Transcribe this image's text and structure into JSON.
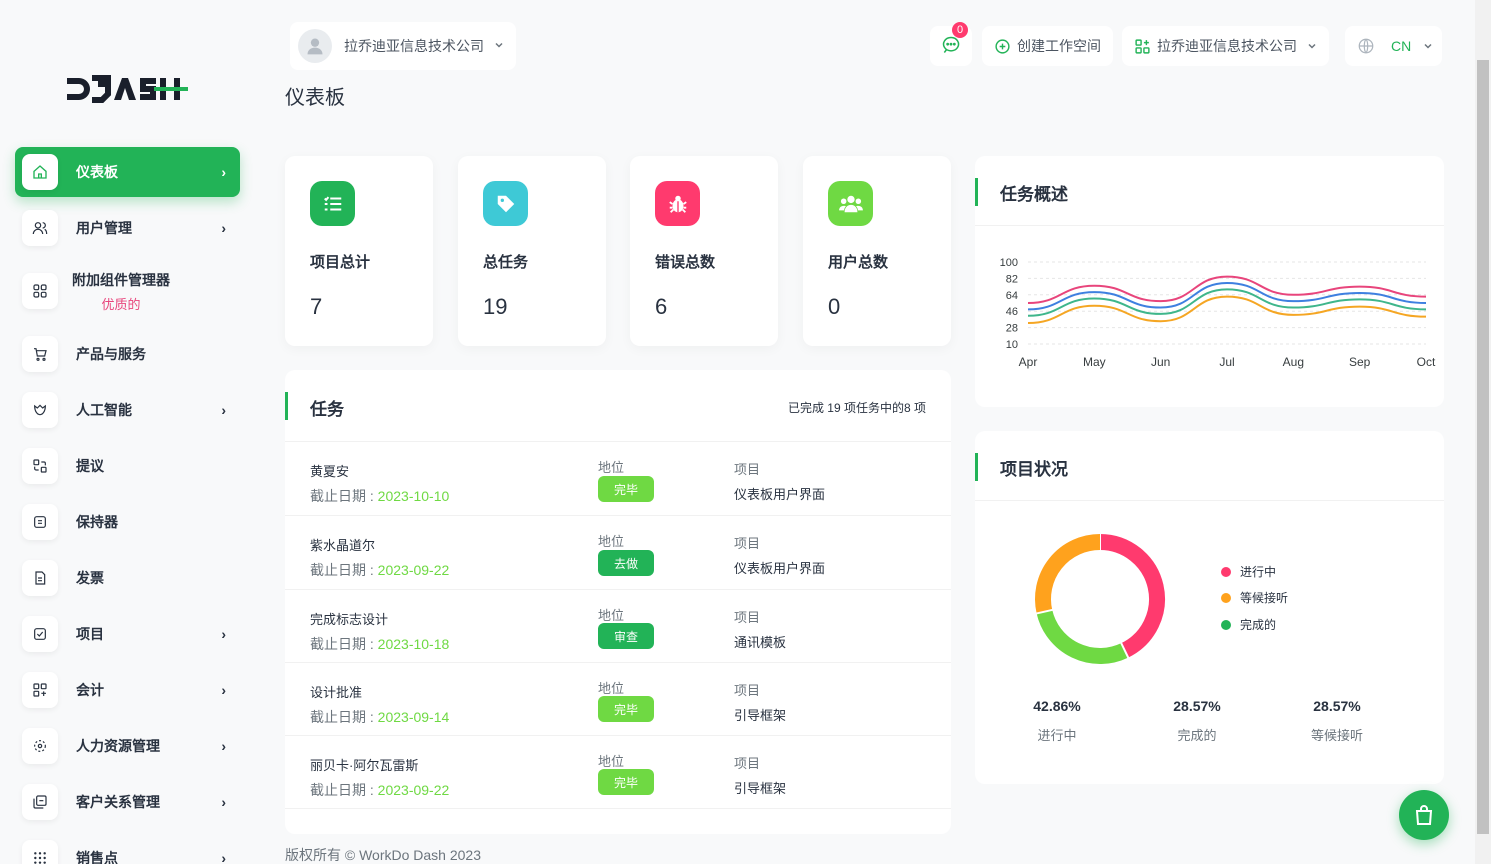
{
  "brand": {
    "logo_text": "DASH",
    "accent": "#22b357"
  },
  "header": {
    "company": "拉乔迪亚信息技术公司",
    "message_count": "0",
    "create_workspace": "创建工作空间",
    "workspace": "拉乔迪亚信息技术公司",
    "language": "CN"
  },
  "page_title": "仪表板",
  "sidebar": {
    "items": [
      {
        "label": "仪表板",
        "icon": "home-icon",
        "chevron": "›"
      },
      {
        "label": "用户管理",
        "icon": "users-icon",
        "chevron": "›"
      },
      {
        "label": "附加组件管理器",
        "sub": "优质的",
        "icon": "grid-icon"
      },
      {
        "label": "产品与服务",
        "icon": "cart-icon"
      },
      {
        "label": "人工智能",
        "icon": "ai-icon",
        "chevron": "›"
      },
      {
        "label": "提议",
        "icon": "proposal-icon"
      },
      {
        "label": "保持器",
        "icon": "retainer-icon"
      },
      {
        "label": "发票",
        "icon": "invoice-icon"
      },
      {
        "label": "项目",
        "icon": "project-icon",
        "chevron": "›"
      },
      {
        "label": "会计",
        "icon": "accounting-icon",
        "chevron": "›"
      },
      {
        "label": "人力资源管理",
        "icon": "hrm-icon",
        "chevron": "›"
      },
      {
        "label": "客户关系管理",
        "icon": "crm-icon",
        "chevron": "›"
      },
      {
        "label": "销售点",
        "icon": "pos-icon",
        "chevron": "›"
      }
    ]
  },
  "stats": [
    {
      "label": "项目总计",
      "value": "7",
      "color": "#22b357",
      "icon": "list-check-icon"
    },
    {
      "label": "总任务",
      "value": "19",
      "color": "#3ec9d6",
      "icon": "tag-icon"
    },
    {
      "label": "错误总数",
      "value": "6",
      "color": "#ff3a6e",
      "icon": "bug-icon"
    },
    {
      "label": "用户总数",
      "value": "0",
      "color": "#6fd943",
      "icon": "users-icon"
    }
  ],
  "tasks": {
    "title": "任务",
    "summary": "已完成 19 项任务中的8 项",
    "status_label": "地位",
    "project_label": "项目",
    "due_prefix": "截止日期 : ",
    "rows": [
      {
        "name": "黄夏安",
        "due": "2023-10-10",
        "status": "完毕",
        "status_color": "#6fd943",
        "project": "仪表板用户界面"
      },
      {
        "name": "紫水晶道尔",
        "due": "2023-09-22",
        "status": "去做",
        "status_color": "#22b357",
        "project": "仪表板用户界面"
      },
      {
        "name": "完成标志设计",
        "due": "2023-10-18",
        "status": "审查",
        "status_color": "#22b357",
        "project": "通讯模板"
      },
      {
        "name": "设计批准",
        "due": "2023-09-14",
        "status": "完毕",
        "status_color": "#6fd943",
        "project": "引导框架"
      },
      {
        "name": "丽贝卡·阿尔瓦雷斯",
        "due": "2023-09-22",
        "status": "完毕",
        "status_color": "#6fd943",
        "project": "引导框架"
      }
    ]
  },
  "overview": {
    "title": "任务概述",
    "chart_data": {
      "type": "line",
      "categories": [
        "Apr",
        "May",
        "Jun",
        "Jul",
        "Aug",
        "Sep",
        "Oct"
      ],
      "yticks": [
        100,
        82,
        64,
        46,
        28,
        10
      ],
      "ylim": [
        10,
        100
      ],
      "grid": true,
      "series": [
        {
          "color": "#e8457c",
          "values": [
            55,
            74,
            57,
            84,
            64,
            73,
            62
          ]
        },
        {
          "color": "#3e80e0",
          "values": [
            48,
            67,
            50,
            77,
            57,
            66,
            55
          ]
        },
        {
          "color": "#3fb68b",
          "values": [
            41,
            60,
            43,
            70,
            50,
            59,
            48
          ]
        },
        {
          "color": "#f5a623",
          "values": [
            33,
            52,
            35,
            62,
            42,
            51,
            40
          ]
        }
      ]
    }
  },
  "project_status": {
    "title": "项目状况",
    "chart_data": {
      "type": "pie",
      "donut": true,
      "labels": [
        "进行中",
        "完成的",
        "等候接听"
      ],
      "values": [
        42.86,
        28.57,
        28.57
      ],
      "colors": [
        "#ff3a6e",
        "#6fd943",
        "#ffa21d"
      ]
    },
    "legend": [
      {
        "label": "进行中",
        "color": "#ff3a6e"
      },
      {
        "label": "等候接听",
        "color": "#ffa21d"
      },
      {
        "label": "完成的",
        "color": "#22b357"
      }
    ],
    "summary": [
      {
        "pct": "42.86%",
        "label": "进行中"
      },
      {
        "pct": "28.57%",
        "label": "完成的"
      },
      {
        "pct": "28.57%",
        "label": "等候接听"
      }
    ]
  },
  "footer": "版权所有 © WorkDo Dash 2023"
}
